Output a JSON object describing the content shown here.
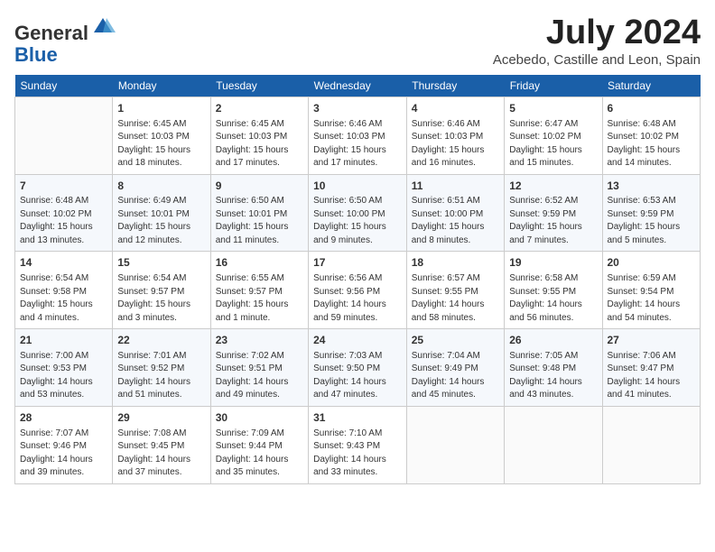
{
  "header": {
    "logo_line1": "General",
    "logo_line2": "Blue",
    "month_title": "July 2024",
    "location": "Acebedo, Castille and Leon, Spain"
  },
  "days_of_week": [
    "Sunday",
    "Monday",
    "Tuesday",
    "Wednesday",
    "Thursday",
    "Friday",
    "Saturday"
  ],
  "weeks": [
    [
      {
        "day": "",
        "sunrise": "",
        "sunset": "",
        "daylight": ""
      },
      {
        "day": "1",
        "sunrise": "6:45 AM",
        "sunset": "10:03 PM",
        "daylight": "15 hours and 18 minutes."
      },
      {
        "day": "2",
        "sunrise": "6:45 AM",
        "sunset": "10:03 PM",
        "daylight": "15 hours and 17 minutes."
      },
      {
        "day": "3",
        "sunrise": "6:46 AM",
        "sunset": "10:03 PM",
        "daylight": "15 hours and 17 minutes."
      },
      {
        "day": "4",
        "sunrise": "6:46 AM",
        "sunset": "10:03 PM",
        "daylight": "15 hours and 16 minutes."
      },
      {
        "day": "5",
        "sunrise": "6:47 AM",
        "sunset": "10:02 PM",
        "daylight": "15 hours and 15 minutes."
      },
      {
        "day": "6",
        "sunrise": "6:48 AM",
        "sunset": "10:02 PM",
        "daylight": "15 hours and 14 minutes."
      }
    ],
    [
      {
        "day": "7",
        "sunrise": "6:48 AM",
        "sunset": "10:02 PM",
        "daylight": "15 hours and 13 minutes."
      },
      {
        "day": "8",
        "sunrise": "6:49 AM",
        "sunset": "10:01 PM",
        "daylight": "15 hours and 12 minutes."
      },
      {
        "day": "9",
        "sunrise": "6:50 AM",
        "sunset": "10:01 PM",
        "daylight": "15 hours and 11 minutes."
      },
      {
        "day": "10",
        "sunrise": "6:50 AM",
        "sunset": "10:00 PM",
        "daylight": "15 hours and 9 minutes."
      },
      {
        "day": "11",
        "sunrise": "6:51 AM",
        "sunset": "10:00 PM",
        "daylight": "15 hours and 8 minutes."
      },
      {
        "day": "12",
        "sunrise": "6:52 AM",
        "sunset": "9:59 PM",
        "daylight": "15 hours and 7 minutes."
      },
      {
        "day": "13",
        "sunrise": "6:53 AM",
        "sunset": "9:59 PM",
        "daylight": "15 hours and 5 minutes."
      }
    ],
    [
      {
        "day": "14",
        "sunrise": "6:54 AM",
        "sunset": "9:58 PM",
        "daylight": "15 hours and 4 minutes."
      },
      {
        "day": "15",
        "sunrise": "6:54 AM",
        "sunset": "9:57 PM",
        "daylight": "15 hours and 3 minutes."
      },
      {
        "day": "16",
        "sunrise": "6:55 AM",
        "sunset": "9:57 PM",
        "daylight": "15 hours and 1 minute."
      },
      {
        "day": "17",
        "sunrise": "6:56 AM",
        "sunset": "9:56 PM",
        "daylight": "14 hours and 59 minutes."
      },
      {
        "day": "18",
        "sunrise": "6:57 AM",
        "sunset": "9:55 PM",
        "daylight": "14 hours and 58 minutes."
      },
      {
        "day": "19",
        "sunrise": "6:58 AM",
        "sunset": "9:55 PM",
        "daylight": "14 hours and 56 minutes."
      },
      {
        "day": "20",
        "sunrise": "6:59 AM",
        "sunset": "9:54 PM",
        "daylight": "14 hours and 54 minutes."
      }
    ],
    [
      {
        "day": "21",
        "sunrise": "7:00 AM",
        "sunset": "9:53 PM",
        "daylight": "14 hours and 53 minutes."
      },
      {
        "day": "22",
        "sunrise": "7:01 AM",
        "sunset": "9:52 PM",
        "daylight": "14 hours and 51 minutes."
      },
      {
        "day": "23",
        "sunrise": "7:02 AM",
        "sunset": "9:51 PM",
        "daylight": "14 hours and 49 minutes."
      },
      {
        "day": "24",
        "sunrise": "7:03 AM",
        "sunset": "9:50 PM",
        "daylight": "14 hours and 47 minutes."
      },
      {
        "day": "25",
        "sunrise": "7:04 AM",
        "sunset": "9:49 PM",
        "daylight": "14 hours and 45 minutes."
      },
      {
        "day": "26",
        "sunrise": "7:05 AM",
        "sunset": "9:48 PM",
        "daylight": "14 hours and 43 minutes."
      },
      {
        "day": "27",
        "sunrise": "7:06 AM",
        "sunset": "9:47 PM",
        "daylight": "14 hours and 41 minutes."
      }
    ],
    [
      {
        "day": "28",
        "sunrise": "7:07 AM",
        "sunset": "9:46 PM",
        "daylight": "14 hours and 39 minutes."
      },
      {
        "day": "29",
        "sunrise": "7:08 AM",
        "sunset": "9:45 PM",
        "daylight": "14 hours and 37 minutes."
      },
      {
        "day": "30",
        "sunrise": "7:09 AM",
        "sunset": "9:44 PM",
        "daylight": "14 hours and 35 minutes."
      },
      {
        "day": "31",
        "sunrise": "7:10 AM",
        "sunset": "9:43 PM",
        "daylight": "14 hours and 33 minutes."
      },
      {
        "day": "",
        "sunrise": "",
        "sunset": "",
        "daylight": ""
      },
      {
        "day": "",
        "sunrise": "",
        "sunset": "",
        "daylight": ""
      },
      {
        "day": "",
        "sunrise": "",
        "sunset": "",
        "daylight": ""
      }
    ]
  ]
}
